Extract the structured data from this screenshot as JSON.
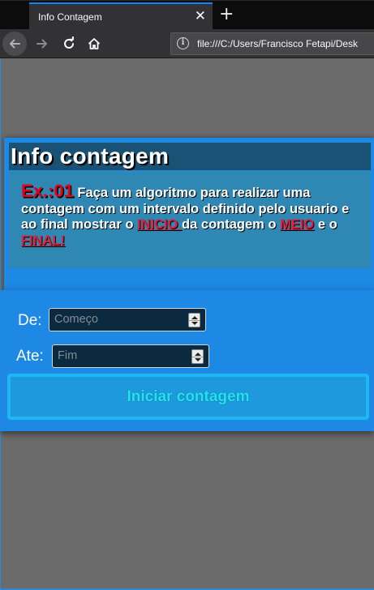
{
  "browser": {
    "tab_title": "Info Contagem",
    "tab_close": "✕",
    "new_tab": "+",
    "url": "file:///C:/Users/Francisco Fetapi/Desk"
  },
  "nav_icons": [
    "back-arrow",
    "forward-arrow",
    "reload",
    "home",
    "info"
  ],
  "info": {
    "heading": "Info contagem",
    "ex_label": "Ex.:01",
    "text_part1": " Faça um algoritmo para realizar uma contagem com um intervalo definido pelo usuario e ao final mostrar o ",
    "highlight_inicio": "INICIO ",
    "text_part2": "da contagem o ",
    "highlight_meio": "MEIO",
    "text_part3": " e o ",
    "highlight_final": "FINAL!"
  },
  "form": {
    "de_label": "De:",
    "de_placeholder": "Começo",
    "ate_label": "Ate:",
    "ate_placeholder": "Fim",
    "button_label": "Iniciar contagem"
  },
  "colors": {
    "page_background": "#6b6b6b",
    "card_blue": "#1e88e5",
    "heading_bg": "#1a5275",
    "text_bg": "#2f87b3",
    "ex_red": "#e3001b",
    "highlight_red": "#e0203a",
    "button_text": "#22e4f0"
  }
}
